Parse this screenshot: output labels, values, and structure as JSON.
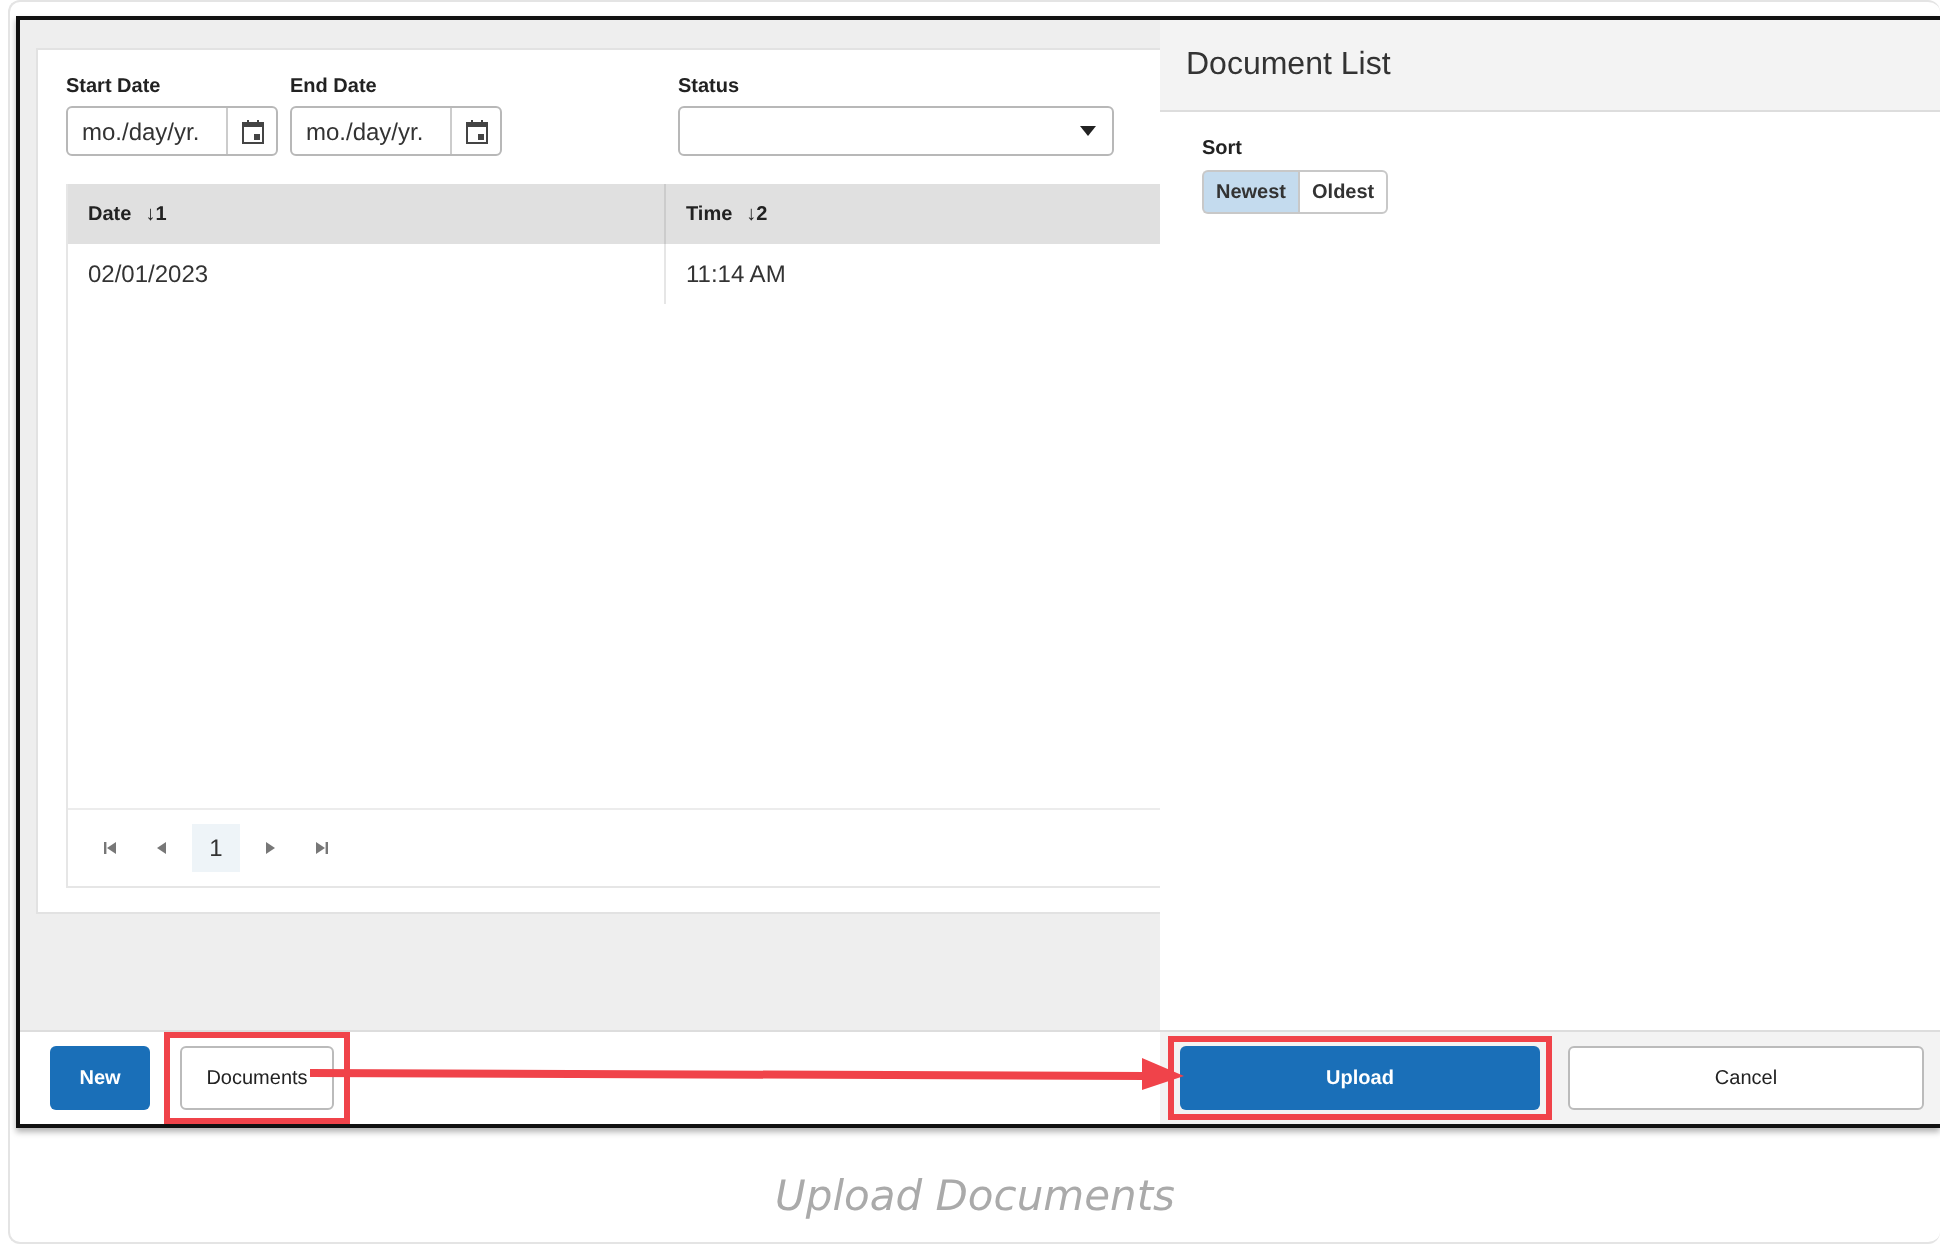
{
  "main": {
    "filters": [
      {
        "kind": "date",
        "label": "Start Date",
        "placeholder": "mo./day/yr."
      },
      {
        "kind": "date",
        "label": "End Date",
        "placeholder": "mo./day/yr."
      },
      {
        "kind": "select",
        "label": "Status"
      }
    ],
    "table": {
      "columns": [
        {
          "label": "Date",
          "sort": "↓1"
        },
        {
          "label": "Time",
          "sort": "↓2"
        }
      ],
      "rows": [
        [
          "02/01/2023",
          "11:14 AM"
        ]
      ]
    },
    "pager": {
      "pages": [
        {
          "label": "1",
          "selected": true
        }
      ]
    }
  },
  "toolbar": {
    "buttons": [
      {
        "label": "New",
        "kind": "primary",
        "highlighted": false
      },
      {
        "label": "Documents",
        "kind": "secondary",
        "highlighted": true
      }
    ]
  },
  "panel": {
    "title": "Document List",
    "sort_label": "Sort",
    "sort_options": [
      {
        "label": "Newest",
        "selected": true
      },
      {
        "label": "Oldest",
        "selected": false
      }
    ],
    "buttons": [
      {
        "label": "Upload",
        "kind": "primary",
        "highlighted": true
      },
      {
        "label": "Cancel",
        "kind": "secondary",
        "highlighted": false
      }
    ]
  },
  "caption": "Upload Documents"
}
